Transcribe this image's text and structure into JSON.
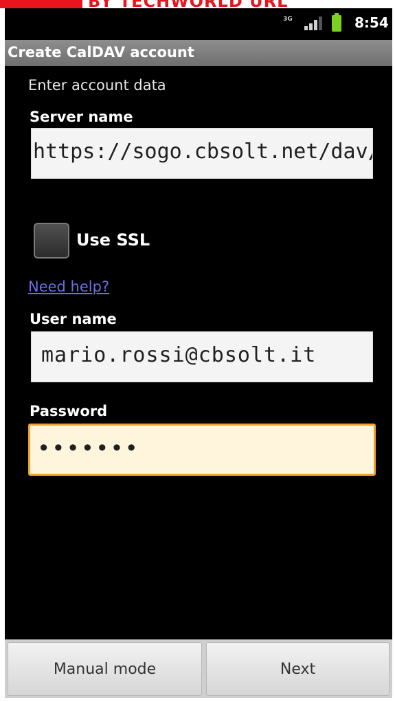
{
  "watermark": {
    "text": "BY TECHWORLD URL"
  },
  "statusbar": {
    "network_label": "3G",
    "signal_icon": "signal-bars-icon",
    "battery_icon": "battery-charging-icon",
    "time": "8:54"
  },
  "titlebar": {
    "title": "Create CalDAV account"
  },
  "form": {
    "subtitle": "Enter account data",
    "server": {
      "label": "Server name",
      "value": "https://sogo.cbsolt.net/dav/"
    },
    "ssl": {
      "label": "Use SSL",
      "checked": false
    },
    "help_link": "Need help?",
    "username": {
      "label": "User name",
      "value": "mario.rossi@cbsolt.it"
    },
    "password": {
      "label": "Password",
      "value": "•••••••"
    }
  },
  "buttons": {
    "manual": "Manual mode",
    "next": "Next"
  },
  "colors": {
    "focus_border": "#f0a030",
    "link": "#6b6fe6",
    "watermark": "#e8141e",
    "battery": "#7ad321"
  }
}
